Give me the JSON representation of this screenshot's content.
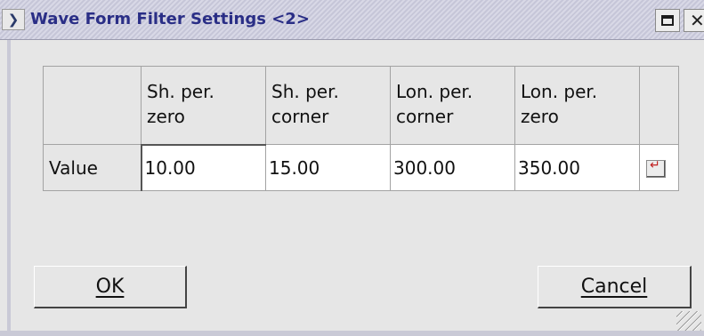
{
  "window": {
    "title": "Wave Form Filter Settings <2>",
    "menu_icon": "chevron-down-icon",
    "controls": [
      "maximize-icon",
      "close-icon"
    ],
    "close_glyph": "✕"
  },
  "table": {
    "headers": [
      {
        "line1": "Sh. per.",
        "line2": "zero"
      },
      {
        "line1": "Sh. per.",
        "line2": "corner"
      },
      {
        "line1": "Lon. per.",
        "line2": "corner"
      },
      {
        "line1": "Lon. per.",
        "line2": "zero"
      }
    ],
    "row_label": "Value",
    "values": [
      "10.00",
      "15.00",
      "300.00",
      "350.00"
    ],
    "revert_icon": "revert-icon"
  },
  "buttons": {
    "ok": "OK",
    "cancel": "Cancel"
  },
  "colors": {
    "title_text": "#2a2e86",
    "window_bg": "#e6e6e6",
    "field_bg": "#ffffff",
    "revert_icon": "#c02020"
  }
}
